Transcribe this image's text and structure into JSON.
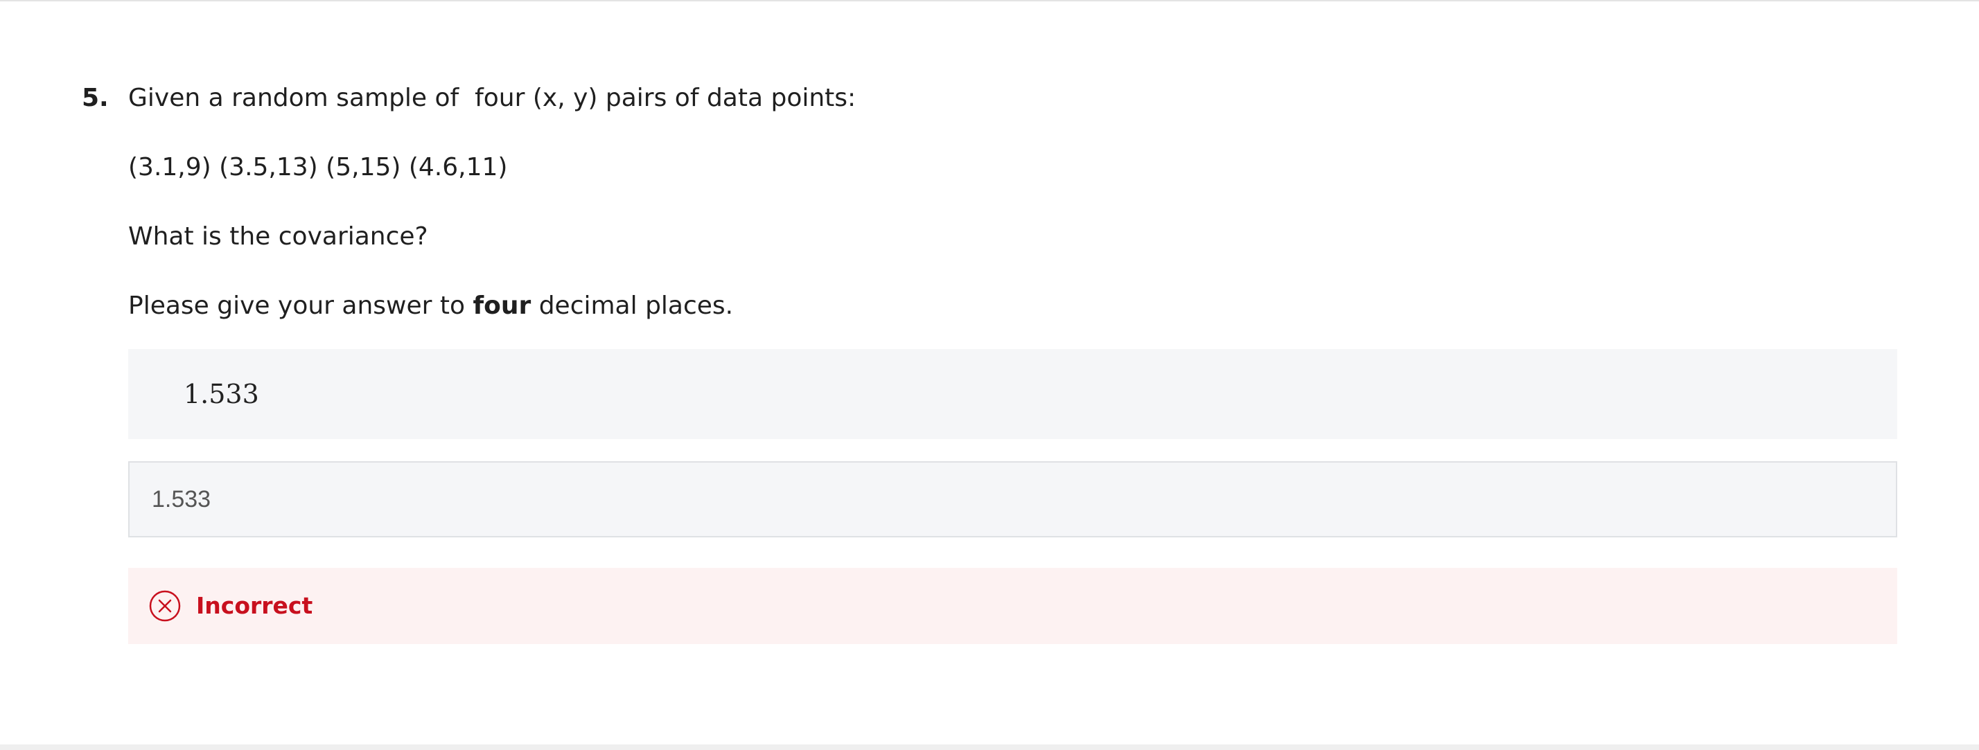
{
  "question": {
    "number": "5.",
    "intro": "Given a random sample of  four (x, y) pairs of data points:",
    "points": "(3.1,9) (3.5,13) (5,15) (4.6,11)",
    "prompt": "What is the covariance?",
    "instruction_before": "Please give your answer to ",
    "instruction_bold": "four",
    "instruction_after": " decimal places."
  },
  "answer": {
    "rendered": "1.533",
    "input_value": "1.533"
  },
  "feedback": {
    "status": "Incorrect",
    "icon": "close-circle-icon",
    "color": "#c8101e"
  }
}
